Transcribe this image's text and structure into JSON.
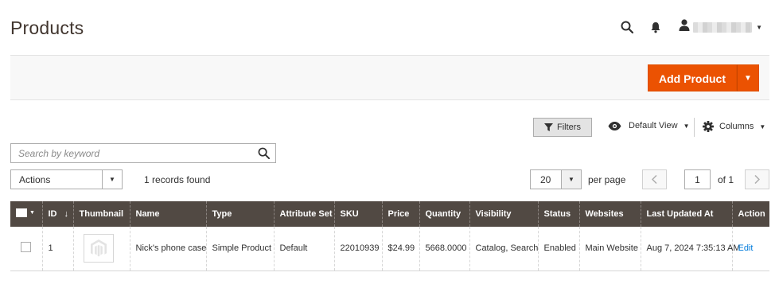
{
  "page": {
    "title": "Products"
  },
  "header": {
    "icons": [
      "search-icon",
      "bell-icon",
      "user-icon",
      "caret-down-icon"
    ]
  },
  "action_bar": {
    "add_product_label": "Add Product",
    "brand_color": "#eb5202"
  },
  "toolbar": {
    "filters_label": "Filters",
    "view_label": "Default View",
    "columns_label": "Columns",
    "search_placeholder": "Search by keyword",
    "actions_label": "Actions",
    "records_found": "1 records found",
    "per_page_value": "20",
    "per_page_label": "per page",
    "current_page": "1",
    "page_of": "of 1"
  },
  "grid": {
    "header_color": "#514943",
    "columns": [
      "ID",
      "Thumbnail",
      "Name",
      "Type",
      "Attribute Set",
      "SKU",
      "Price",
      "Quantity",
      "Visibility",
      "Status",
      "Websites",
      "Last Updated At",
      "Action"
    ],
    "rows": [
      {
        "id": "1",
        "thumbnail": "magento-logo-placeholder",
        "name": "Nick's phone case",
        "type": "Simple Product",
        "attribute_set": "Default",
        "sku": "22010939",
        "price": "$24.99",
        "quantity": "5668.0000",
        "visibility": "Catalog, Search",
        "status": "Enabled",
        "websites": "Main Website",
        "last_updated": "Aug 7, 2024 7:35:13 AM",
        "action": "Edit"
      }
    ]
  }
}
